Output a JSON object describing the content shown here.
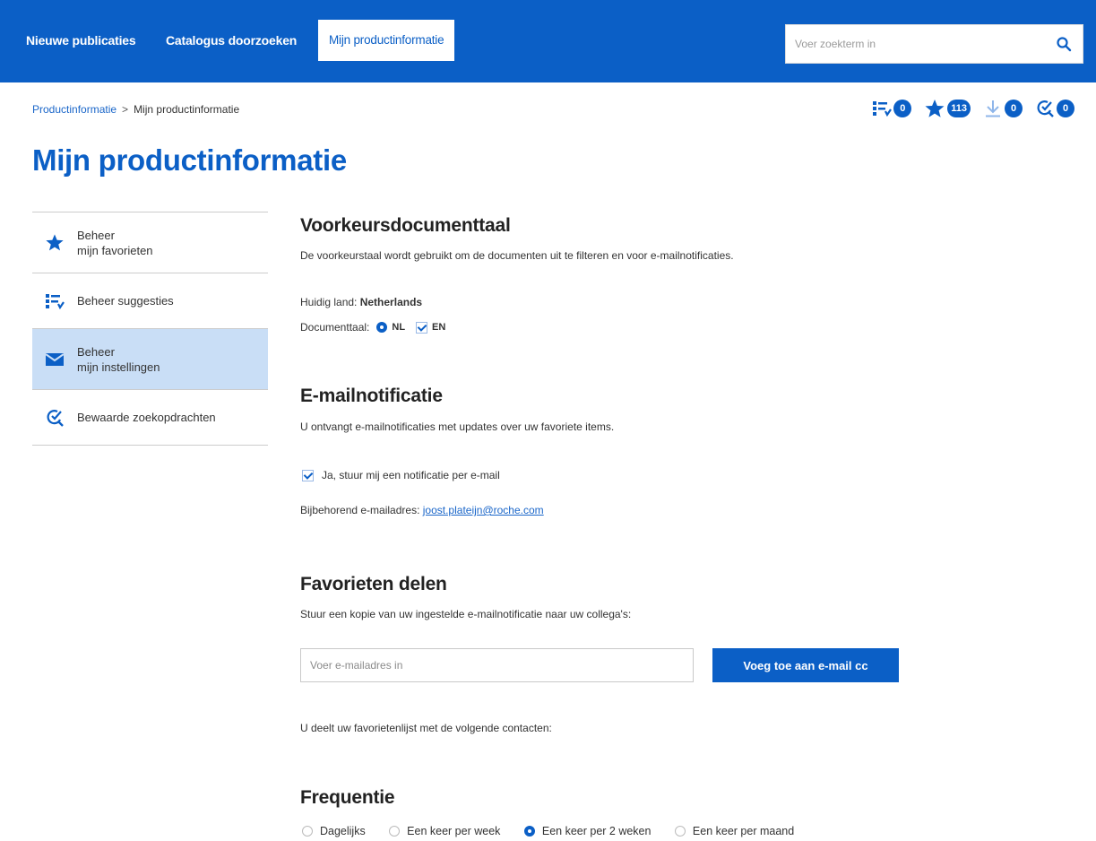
{
  "nav": {
    "items": [
      {
        "label": "Nieuwe publicaties"
      },
      {
        "label": "Catalogus doorzoeken"
      },
      {
        "label": "Mijn productinformatie"
      }
    ],
    "search_placeholder": "Voer zoekterm in"
  },
  "breadcrumb": {
    "root": "Productinformatie",
    "separator": ">",
    "current": "Mijn productinformatie"
  },
  "counters": {
    "suggestions": "0",
    "favorites": "113",
    "downloads": "0",
    "saved_searches": "0"
  },
  "page_title": "Mijn productinformatie",
  "sidebar": {
    "items": [
      {
        "line1": "Beheer",
        "line2": "mijn favorieten",
        "icon": "star-icon"
      },
      {
        "line1": "Beheer suggesties",
        "line2": "",
        "icon": "suggestions-icon"
      },
      {
        "line1": "Beheer",
        "line2": "mijn instellingen",
        "icon": "mail-icon"
      },
      {
        "line1": "Bewaarde zoekopdrachten",
        "line2": "",
        "icon": "saved-search-icon"
      }
    ]
  },
  "language": {
    "title": "Voorkeursdocumenttaal",
    "description": "De voorkeurstaal wordt gebruikt om de documenten uit te filteren en voor e-mailnotificaties.",
    "country_label": "Huidig land:",
    "country_value": "Netherlands",
    "doc_lang_label": "Documenttaal:",
    "opt_nl": "NL",
    "opt_en": "EN"
  },
  "email_notification": {
    "title": "E-mailnotificatie",
    "description": "U ontvangt e-mailnotificaties met updates over uw favoriete items.",
    "checkbox_label": "Ja, stuur mij een notificatie per e-mail",
    "address_label": "Bijbehorend e-mailadres:",
    "address": "joost.plateijn@roche.com"
  },
  "share": {
    "title": "Favorieten delen",
    "description": "Stuur een kopie van uw ingestelde e-mailnotificatie naar uw collega's:",
    "input_placeholder": "Voer e-mailadres in",
    "button": "Voeg toe aan e-mail cc",
    "contacts_text": "U deelt uw favorietenlijst met de volgende contacten:"
  },
  "frequency": {
    "title": "Frequentie",
    "options": [
      {
        "label": "Dagelijks"
      },
      {
        "label": "Een keer per week"
      },
      {
        "label": "Een keer per 2 weken"
      },
      {
        "label": "Een keer per maand"
      }
    ],
    "selected": "Een keer per 2 weken"
  },
  "colors": {
    "brand": "#0b5fc6",
    "active_bg": "#c9def6"
  }
}
